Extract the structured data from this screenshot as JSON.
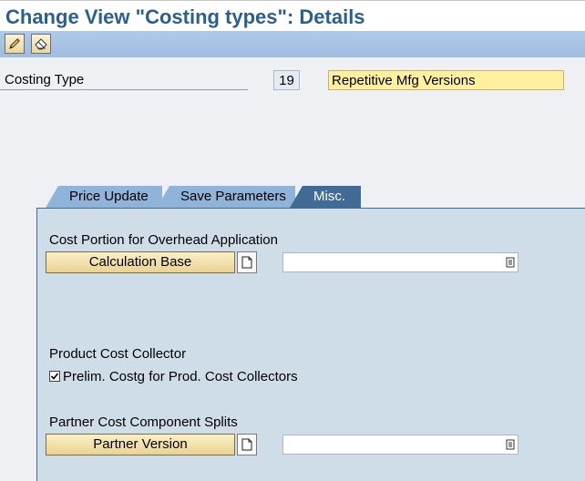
{
  "window": {
    "title": "Change View \"Costing types\": Details"
  },
  "toolbar": {
    "buttons": [
      {
        "icon": "pencil-icon"
      },
      {
        "icon": "eraser-icon"
      }
    ]
  },
  "costing_type": {
    "label": "Costing Type",
    "code": "19",
    "name": "Repetitive Mfg Versions"
  },
  "tabs": [
    {
      "label": "Price Update",
      "active": false
    },
    {
      "label": "Save Parameters",
      "active": false
    },
    {
      "label": "Misc.",
      "active": true
    }
  ],
  "misc": {
    "overhead": {
      "heading": "Cost Portion for Overhead Application",
      "button": "Calculation Base",
      "value": ""
    },
    "collector": {
      "heading": "Product Cost Collector",
      "checkbox_label": "Prelim. Costg for Prod. Cost Collectors",
      "checked": true
    },
    "partner": {
      "heading": "Partner Cost Component Splits",
      "button": "Partner Version",
      "value": ""
    }
  },
  "colors": {
    "title": "#2a5f8f",
    "toolbar": "#a8c5e6",
    "panel": "#cfdde9",
    "active_tab": "#3f6b96",
    "inactive_tab": "#8fb3d9",
    "highlight_field": "#fff0a0"
  }
}
